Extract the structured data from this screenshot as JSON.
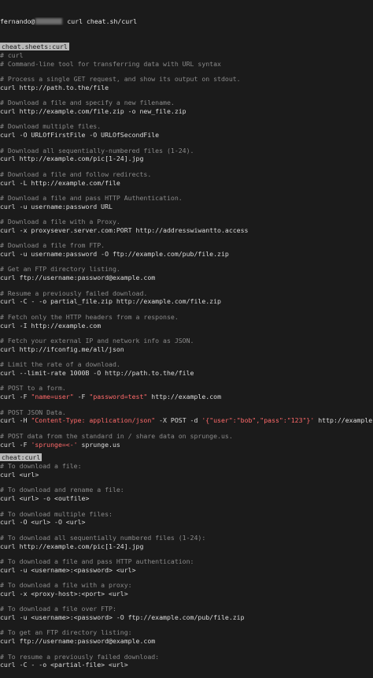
{
  "prompt": {
    "user_host": "fernando@",
    "command": "curl cheat.sh/curl"
  },
  "sections": [
    {
      "badge": "cheat.sheets:curl",
      "lines": [
        {
          "type": "comment",
          "text": "# curl"
        },
        {
          "type": "comment",
          "text": "# Command-line tool for transferring data with URL syntax"
        },
        {
          "type": "blank"
        },
        {
          "type": "comment",
          "text": "# Process a single GET request, and show its output on stdout."
        },
        {
          "type": "cmd",
          "text": "curl http://path.to.the/file"
        },
        {
          "type": "blank"
        },
        {
          "type": "comment",
          "text": "# Download a file and specify a new filename."
        },
        {
          "type": "cmd",
          "text": "curl http://example.com/file.zip -o new_file.zip"
        },
        {
          "type": "blank"
        },
        {
          "type": "comment",
          "text": "# Download multiple files."
        },
        {
          "type": "cmd",
          "text": "curl -O URLOfFirstFile -O URLOfSecondFile"
        },
        {
          "type": "blank"
        },
        {
          "type": "comment",
          "text": "# Download all sequentially-numbered files (1-24)."
        },
        {
          "type": "cmd",
          "text": "curl http://example.com/pic[1-24].jpg"
        },
        {
          "type": "blank"
        },
        {
          "type": "comment",
          "text": "# Download a file and follow redirects."
        },
        {
          "type": "cmd",
          "text": "curl -L http://example.com/file"
        },
        {
          "type": "blank"
        },
        {
          "type": "comment",
          "text": "# Download a file and pass HTTP Authentication."
        },
        {
          "type": "cmd",
          "text": "curl -u username:password URL"
        },
        {
          "type": "blank"
        },
        {
          "type": "comment",
          "text": "# Download a file with a Proxy."
        },
        {
          "type": "cmd",
          "text": "curl -x proxysever.server.com:PORT http://addresswiwantto.access"
        },
        {
          "type": "blank"
        },
        {
          "type": "comment",
          "text": "# Download a file from FTP."
        },
        {
          "type": "cmd",
          "text": "curl -u username:password -O ftp://example.com/pub/file.zip"
        },
        {
          "type": "blank"
        },
        {
          "type": "comment",
          "text": "# Get an FTP directory listing."
        },
        {
          "type": "cmd",
          "text": "curl ftp://username:password@example.com"
        },
        {
          "type": "blank"
        },
        {
          "type": "comment",
          "text": "# Resume a previously failed download."
        },
        {
          "type": "cmd",
          "text": "curl -C - -o partial_file.zip http://example.com/file.zip"
        },
        {
          "type": "blank"
        },
        {
          "type": "comment",
          "text": "# Fetch only the HTTP headers from a response."
        },
        {
          "type": "cmd",
          "text": "curl -I http://example.com"
        },
        {
          "type": "blank"
        },
        {
          "type": "comment",
          "text": "# Fetch your external IP and network info as JSON."
        },
        {
          "type": "cmd",
          "text": "curl http://ifconfig.me/all/json"
        },
        {
          "type": "blank"
        },
        {
          "type": "comment",
          "text": "# Limit the rate of a download."
        },
        {
          "type": "cmd",
          "text": "curl --limit-rate 1000B -O http://path.to.the/file"
        },
        {
          "type": "blank"
        },
        {
          "type": "comment",
          "text": "# POST to a form."
        },
        {
          "type": "form",
          "pre": "curl -F ",
          "a": "\"name=user\"",
          "mid": " -F ",
          "b": "\"password=test\"",
          "post": " http://example.com"
        },
        {
          "type": "blank"
        },
        {
          "type": "comment",
          "text": "# POST JSON Data."
        },
        {
          "type": "json",
          "pre": "curl -H ",
          "a": "\"Content-Type: application/json\"",
          "mid": " -X POST -d ",
          "b": "'{\"user\":\"bob\",\"pass\":\"123\"}'",
          "post": " http://example.com"
        },
        {
          "type": "blank"
        },
        {
          "type": "comment",
          "text": "# POST data from the standard in / share data on sprunge.us."
        },
        {
          "type": "sprunge",
          "pre": "curl -F ",
          "a": "'sprunge=<-'",
          "post": " sprunge.us"
        }
      ]
    },
    {
      "badge": "cheat:curl",
      "lines": [
        {
          "type": "comment",
          "text": "# To download a file:"
        },
        {
          "type": "cmd",
          "text": "curl <url>"
        },
        {
          "type": "blank"
        },
        {
          "type": "comment",
          "text": "# To download and rename a file:"
        },
        {
          "type": "cmd",
          "text": "curl <url> -o <outfile>"
        },
        {
          "type": "blank"
        },
        {
          "type": "comment",
          "text": "# To download multiple files:"
        },
        {
          "type": "cmd",
          "text": "curl -O <url> -O <url>"
        },
        {
          "type": "blank"
        },
        {
          "type": "comment",
          "text": "# To download all sequentially numbered files (1-24):"
        },
        {
          "type": "cmd",
          "text": "curl http://example.com/pic[1-24].jpg"
        },
        {
          "type": "blank"
        },
        {
          "type": "comment",
          "text": "# To download a file and pass HTTP authentication:"
        },
        {
          "type": "cmd",
          "text": "curl -u <username>:<password> <url>"
        },
        {
          "type": "blank"
        },
        {
          "type": "comment",
          "text": "# To download a file with a proxy:"
        },
        {
          "type": "cmd",
          "text": "curl -x <proxy-host>:<port> <url>"
        },
        {
          "type": "blank"
        },
        {
          "type": "comment",
          "text": "# To download a file over FTP:"
        },
        {
          "type": "cmd",
          "text": "curl -u <username>:<password> -O ftp://example.com/pub/file.zip"
        },
        {
          "type": "blank"
        },
        {
          "type": "comment",
          "text": "# To get an FTP directory listing:"
        },
        {
          "type": "cmd",
          "text": "curl ftp://username:password@example.com"
        },
        {
          "type": "blank"
        },
        {
          "type": "comment",
          "text": "# To resume a previously failed download:"
        },
        {
          "type": "cmd",
          "text": "curl -C - -o <partial-file> <url>"
        }
      ]
    }
  ],
  "colors": {
    "background": "#1b1b1b",
    "comment": "#8a8a8a",
    "text": "#d9d9d9",
    "highlight": "#ff6a6a",
    "badge_bg": "#b9b9b9"
  }
}
